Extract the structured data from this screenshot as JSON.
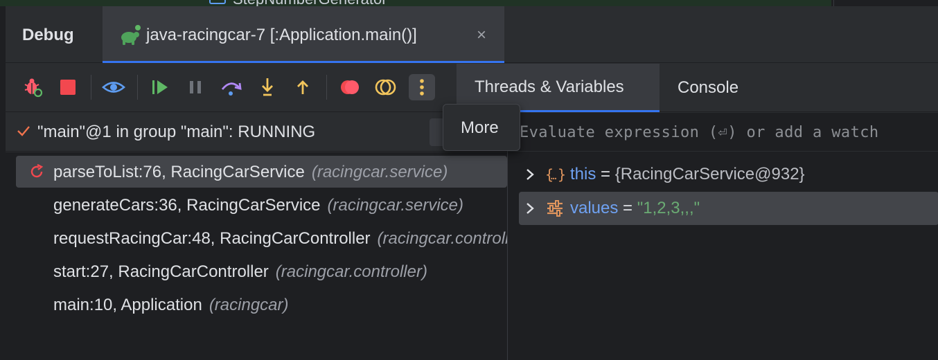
{
  "header": {
    "panel_title": "Debug",
    "session_tab_label": "java-racingcar-7 [:Application.main()]",
    "session_close": "×"
  },
  "toolbar": {
    "buttons": [
      {
        "name": "rerun-debug",
        "icon": "bug-rerun-icon",
        "color": "#ff5a6a"
      },
      {
        "name": "stop",
        "icon": "stop-icon",
        "color": "#f2484f"
      },
      {
        "name": "view-breakpoints",
        "icon": "eye-icon",
        "color": "#5e9cf0"
      },
      {
        "name": "resume",
        "icon": "resume-icon",
        "color": "#5fb865"
      },
      {
        "name": "pause",
        "icon": "pause-icon",
        "color": "#6f737a"
      },
      {
        "name": "step-over",
        "icon": "step-over-icon",
        "color": "#b189f5"
      },
      {
        "name": "step-into",
        "icon": "step-into-icon",
        "color": "#f2c55c"
      },
      {
        "name": "step-out",
        "icon": "step-out-icon",
        "color": "#f2c55c"
      },
      {
        "name": "view-breakpoints",
        "icon": "breakpoints-icon",
        "color": "#f2484f"
      },
      {
        "name": "mute-breakpoints",
        "icon": "mute-breakpoints-icon",
        "color": "#f2c55c"
      },
      {
        "name": "more",
        "icon": "more-vertical-icon",
        "color": "#f2c55c"
      }
    ]
  },
  "right_tabs": {
    "threads_variables": "Threads & Variables",
    "console": "Console"
  },
  "tooltip": {
    "text": "More"
  },
  "thread": {
    "label": "\"main\"@1 in group \"main\": RUNNING"
  },
  "frames": [
    {
      "method": "parseToList:76, RacingCarService",
      "package": "(racingcar.service)",
      "selected": true
    },
    {
      "method": "generateCars:36, RacingCarService",
      "package": "(racingcar.service)",
      "selected": false
    },
    {
      "method": "requestRacingCar:48, RacingCarController",
      "package": "(racingcar.controller)",
      "selected": false
    },
    {
      "method": "start:27, RacingCarController",
      "package": "(racingcar.controller)",
      "selected": false
    },
    {
      "method": "main:10, Application",
      "package": "(racingcar)",
      "selected": false
    }
  ],
  "variables": {
    "eval_placeholder": "Evaluate expression (⏎) or add a watch",
    "items": [
      {
        "name": "this",
        "equals": "=",
        "value": "{RacingCarService@932}",
        "icon": "object-icon",
        "selected": false
      },
      {
        "name": "values",
        "equals": "=",
        "value": "\"1,2,3,,,\"",
        "icon": "field-icon",
        "selected": true
      }
    ]
  },
  "editor_strip": {
    "text": "StepNumberGenerator"
  }
}
